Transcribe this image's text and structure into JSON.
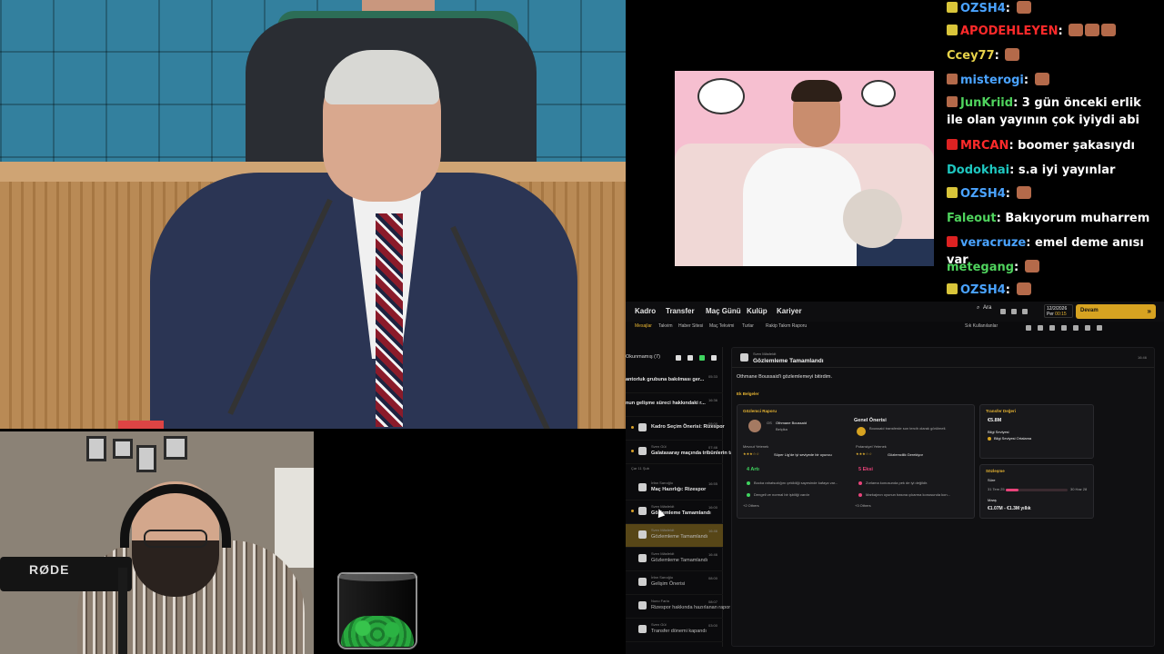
{
  "webcam": {
    "mic_brand": "RØDE"
  },
  "chat": {
    "messages": [
      {
        "user": "OZSH4",
        "text": "",
        "color": "#4aa3ff",
        "badge": "#d9c53a",
        "emotes": 1
      },
      {
        "user": "APODEHLEYEN",
        "text": "",
        "color": "#ff2a2a",
        "badge": "#d9c53a",
        "emotes": 3
      },
      {
        "user": "Ccey77",
        "text": "",
        "color": "#e8d34a",
        "badge": "",
        "emotes": 1
      },
      {
        "user": "misterogi",
        "text": "",
        "color": "#4aa3ff",
        "badge": "#b46a4a",
        "emotes": 1
      },
      {
        "user": "JunKriid",
        "text": "3 gün önceki erlik ile olan yayının çok iyiydi abi",
        "color": "#4fd35d",
        "badge": "#b46a4a",
        "emotes": 0
      },
      {
        "user": "MRCAN",
        "text": "boomer şakasıydı",
        "color": "#ff2a2a",
        "badge": "#d22",
        "emotes": 0
      },
      {
        "user": "Dodokhai",
        "text": "s.a iyi yayınlar",
        "color": "#1ec7c0",
        "badge": "",
        "emotes": 0
      },
      {
        "user": "OZSH4",
        "text": "",
        "color": "#4aa3ff",
        "badge": "#d9c53a",
        "emotes": 1
      },
      {
        "user": "Faleout",
        "text": "Bakıyorum muharrem",
        "color": "#4fd35d",
        "badge": "",
        "emotes": 0
      },
      {
        "user": "veracruze",
        "text": "emel deme anısı var",
        "color": "#4aa3ff",
        "badge": "#d22",
        "emotes": 0
      },
      {
        "user": "metegang",
        "text": "",
        "color": "#4fd35d",
        "badge": "",
        "emotes": 1
      },
      {
        "user": "OZSH4",
        "text": "",
        "color": "#4aa3ff",
        "badge": "#d9c53a",
        "emotes": 1
      }
    ]
  },
  "game": {
    "nav": [
      "Kadro",
      "Transfer",
      "Maç Günü",
      "Kulüp",
      "Kariyer"
    ],
    "subnav": [
      "Mesajlar",
      "Takvim",
      "Haber Sitesi",
      "Maç Tekvimi",
      "Turlar",
      "Rakip Takım Raporu"
    ],
    "search_label": "Ara",
    "date": "12/2/2026",
    "day": "Per",
    "time": "00:15",
    "continue_label": "Devam",
    "quick_label": "Sık Kullanılanlar",
    "inbox_header": "Okunmamış (7)",
    "inbox": [
      {
        "sender": "",
        "subject": "antorluk grubuna bakılması ger...",
        "time": "05:33",
        "bold": true,
        "dot": false
      },
      {
        "sender": "",
        "subject": "nun gelişme süreci hakkındaki r...",
        "time": "16:36",
        "bold": true,
        "dot": false
      },
      {
        "sender": "",
        "subject": "Kadro Seçim Önerisi: Rizespor",
        "time": "08:00",
        "bold": true,
        "dot": true
      },
      {
        "sender": "Sven Gül",
        "subject": "Galatasaray maçında tribünlerin tamamen dolu o...",
        "time": "07:46",
        "bold": true,
        "dot": true
      },
      {
        "sender": "İrfan Sarıoğlu",
        "subject": "Maç Hazırlığı: Rizespor",
        "time": "16:55",
        "bold": true,
        "dot": false
      },
      {
        "sender": "Sven Mäsfeldt",
        "subject": "Gözlemleme Tamamlandı",
        "time": "16:00",
        "bold": true,
        "dot": true
      },
      {
        "sender": "Sven Mäsfeldt",
        "subject": "Gözlemleme Tamamlandı",
        "time": "16:46",
        "bold": false,
        "dot": false,
        "selected": true
      },
      {
        "sender": "Sven Mäsfeldt",
        "subject": "Gözlemleme Tamamlandı",
        "time": "16:46",
        "bold": false,
        "dot": false
      },
      {
        "sender": "İrfan Sarıoğlu",
        "subject": "Gelişim Önerisi",
        "time": "08:00",
        "bold": false,
        "dot": false
      },
      {
        "sender": "Nuno Faria",
        "subject": "Rizespor hakkında hazırlanan rapor",
        "time": "08:07",
        "bold": false,
        "dot": false
      },
      {
        "sender": "Sven Gül",
        "subject": "Transfer dönemi kapandı",
        "time": "03:00",
        "bold": false,
        "dot": false
      }
    ],
    "section_date": "Çar 11 Şub",
    "detail": {
      "sender": "Sven Mäsfeldt",
      "subject": "Gözlemleme Tamamlandı",
      "time": "16:46",
      "body": "Othmane Boussaid'i gözlemlemeyi bitirdim.",
      "attachments_label": "Ek Belgeler",
      "report_title": "Gözlemci Raporu",
      "player_name": "Othmane Boussaid",
      "player_pos": "OS",
      "player_club": "Belçika",
      "general_title": "Genel Önerisi",
      "general_text": "Boussaid transferde son tercih olarak görülmeli.",
      "current_label": "Mevcut Yetenek",
      "current_stars": "★★★☆☆",
      "current_text": "Süper Lig'de iyi seviyede bir oyuncu",
      "potential_label": "Potansiyel Yetenek",
      "potential_stars": "★★★☆☆",
      "potential_text": "Gözlemcilik Gerekiyor",
      "pros_title": "4 Artı",
      "pros": [
        "Bocka rahatsızlığını çekildiği sayesinde kafaya var...",
        "Dengeli ve normal bir işbiliği vardır",
        "+2 Others"
      ],
      "cons_title": "5 Eksi",
      "cons": [
        "Zorlama konusunda pek de iyi değildir.",
        "Markajının oyunun basına çıkarma konusunda kon...",
        "+3 Others"
      ],
      "transfer_title": "Transfer Değeri",
      "transfer_value": "€5.8M",
      "knowledge_label": "Bilgi Seviyesi",
      "knowledge_value": "Bilgi Seviyesi Ortalama",
      "contract_title": "Sözleşme",
      "duration_label": "Süre",
      "contract_start": "31 Tem 25",
      "contract_end": "30 Haz 28",
      "contract_progress": 0.2,
      "wage_label": "Maaş",
      "wage_value": "€1.07M - €1.3M yıllık"
    }
  }
}
